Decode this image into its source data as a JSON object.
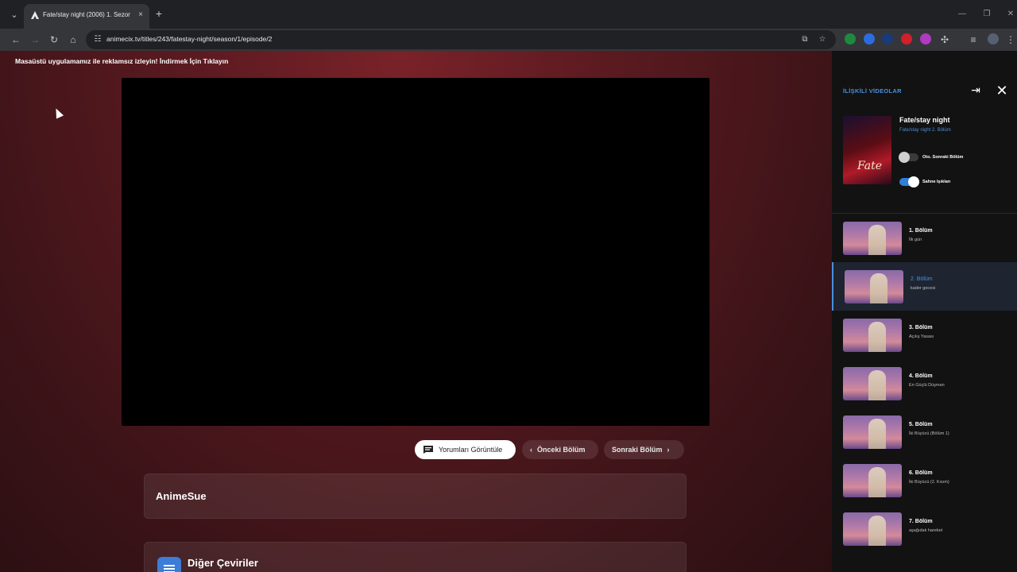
{
  "browser": {
    "tab_title": "Fate/stay night (2006) 1. Sezon",
    "url": "animecix.tv/titles/243/fatestay-night/season/1/episode/2",
    "new_tab": "+",
    "tab_close": "×"
  },
  "page": {
    "promo_text": "Masaüstü uygulamamız ile reklamsız izleyin! İndirmek İçin Tıklayın",
    "buttons": {
      "comments": "Yorumları Görüntüle",
      "prev": "Önceki Bölüm",
      "next": "Sonraki Bölüm"
    },
    "cards": {
      "fansub": "AnimeSue",
      "other_translations": "Diğer Çeviriler"
    }
  },
  "sidebar": {
    "header": "İLİŞKİLİ VİDEOLAR",
    "show": {
      "title": "Fate/stay night",
      "subtitle": "Fate/stay night 2. Bölüm",
      "poster_text": "Fate"
    },
    "toggles": {
      "autoplay_label": "Oto. Sonraki Bölüm",
      "autoplay_on": false,
      "scene_skip_label": "Sahne Işıkları",
      "scene_skip_on": true
    },
    "episodes": [
      {
        "title": "1. Bölüm",
        "subtitle": "İlk gün"
      },
      {
        "title": "2. Bölüm",
        "subtitle": "kader gecesi"
      },
      {
        "title": "3. Bölüm",
        "subtitle": "Açılış Yasası"
      },
      {
        "title": "4. Bölüm",
        "subtitle": "En Güçlü Düşman"
      },
      {
        "title": "5. Bölüm",
        "subtitle": "İki Büyücü (Bölüm 1)"
      },
      {
        "title": "6. Bölüm",
        "subtitle": "İki Büyücü (2. Kısım)"
      },
      {
        "title": "7. Bölüm",
        "subtitle": "aşağıdak hareket"
      }
    ],
    "active_episode": 2
  },
  "colors": {
    "accent": "#4a8fdc",
    "page_bg": "#5a1a20",
    "sidebar_bg": "#121212"
  }
}
